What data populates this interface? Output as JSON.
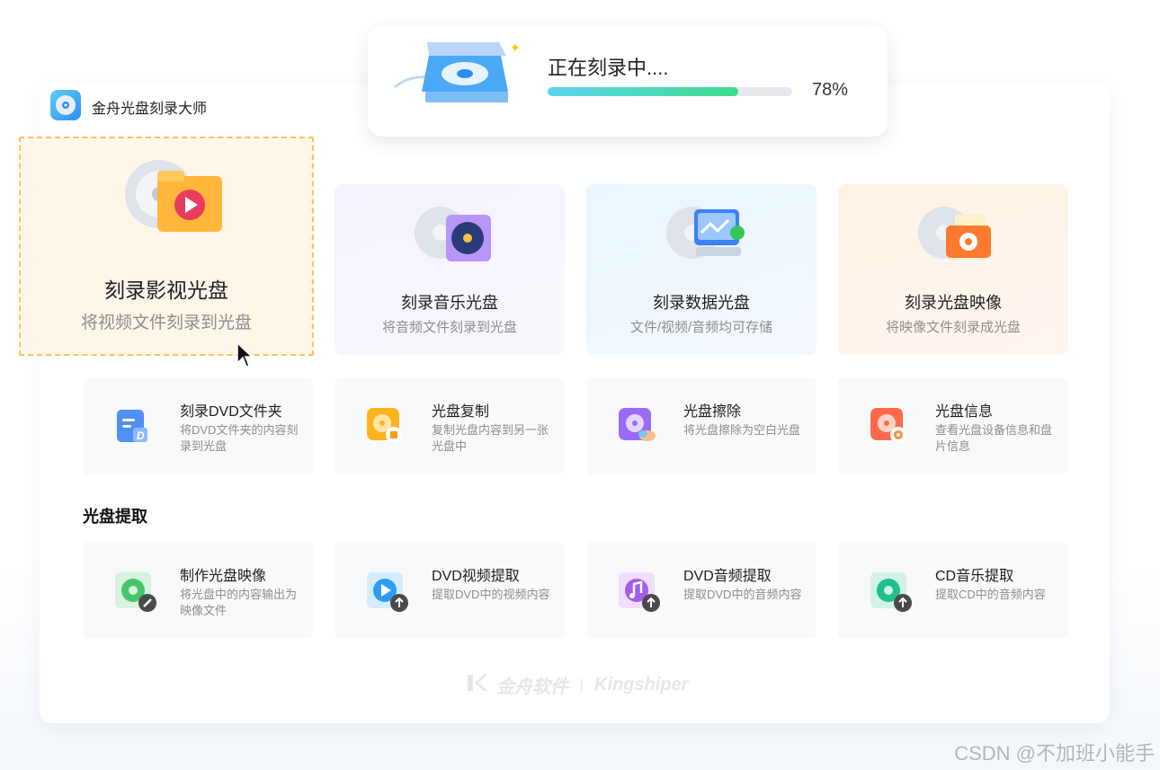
{
  "app": {
    "title": "金舟光盘刻录大师"
  },
  "progress": {
    "status": "正在刻录中....",
    "value": 0.78,
    "percent_label": "78%"
  },
  "features": {
    "video": {
      "title": "刻录影视光盘",
      "subtitle": "将视频文件刻录到光盘"
    },
    "music": {
      "title": "刻录音乐光盘",
      "subtitle": "将音频文件刻录到光盘"
    },
    "data": {
      "title": "刻录数据光盘",
      "subtitle": "文件/视频/音频均可存储"
    },
    "image": {
      "title": "刻录光盘映像",
      "subtitle": "将映像文件刻录成光盘"
    }
  },
  "tools": [
    {
      "title": "刻录DVD文件夹",
      "desc": "将DVD文件夹的内容刻录到光盘",
      "icon": "dvd-folder-icon",
      "color": "#4f8ff7"
    },
    {
      "title": "光盘复制",
      "desc": "复制光盘内容到另一张光盘中",
      "icon": "disc-copy-icon",
      "color": "#ffb41f"
    },
    {
      "title": "光盘擦除",
      "desc": "将光盘擦除为空白光盘",
      "icon": "disc-erase-icon",
      "color": "#9a6cf5"
    },
    {
      "title": "光盘信息",
      "desc": "查看光盘设备信息和盘片信息",
      "icon": "disc-info-icon",
      "color": "#ff6a4d"
    }
  ],
  "extract": {
    "section_title": "光盘提取",
    "items": [
      {
        "title": "制作光盘映像",
        "desc": "将光盘中的内容输出为映像文件",
        "icon": "make-image-icon",
        "color": "#47c46a"
      },
      {
        "title": "DVD视频提取",
        "desc": "提取DVD中的视频内容",
        "icon": "dvd-video-extract-icon",
        "color": "#2e9cf2"
      },
      {
        "title": "DVD音频提取",
        "desc": "提取DVD中的音频内容",
        "icon": "dvd-audio-extract-icon",
        "color": "#a35cf0"
      },
      {
        "title": "CD音乐提取",
        "desc": "提取CD中的音频内容",
        "icon": "cd-music-extract-icon",
        "color": "#1fbf8f"
      }
    ]
  },
  "footer": {
    "brand_cn": "金舟软件",
    "brand_en": "Kingshiper"
  },
  "watermark": "CSDN @不加班小能手"
}
